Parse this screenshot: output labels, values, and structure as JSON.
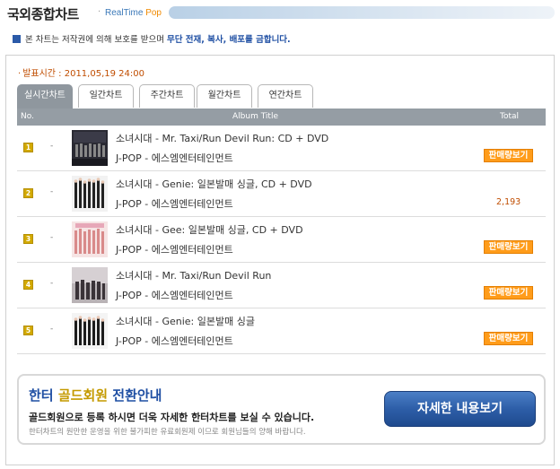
{
  "header": {
    "title": "국외종합차트",
    "separator": "·",
    "brand_realtime": "RealTime",
    "brand_pop": "Pop"
  },
  "notice": {
    "text": "본 차트는 저작권에 의해 보호를 받으며",
    "warning": "무단 전재, 복사, 배포를 금합니다."
  },
  "release_time": {
    "marker": "·",
    "text": "발표시간 : 2011,05,19 24:00"
  },
  "tabs": [
    {
      "label": "실시간차트",
      "active": true
    },
    {
      "label": "일간차트",
      "active": false
    },
    {
      "label": "주간차트",
      "active": false
    },
    {
      "label": "월간차트",
      "active": false
    },
    {
      "label": "연간차트",
      "active": false
    }
  ],
  "table": {
    "columns": {
      "no": "No.",
      "album_title": "Album Title",
      "total": "Total"
    },
    "rows": [
      {
        "rank": "1",
        "change": "-",
        "title": "소녀시대 - Mr. Taxi/Run Devil Run: CD + DVD",
        "artist": "J-POP - 에스엠엔터테인먼트",
        "total_button": "판매량보기",
        "total_value": ""
      },
      {
        "rank": "2",
        "change": "-",
        "title": "소녀시대 - Genie: 일본발매 싱글, CD + DVD",
        "artist": "J-POP - 에스엠엔터테인먼트",
        "total_button": "",
        "total_value": "2,193"
      },
      {
        "rank": "3",
        "change": "-",
        "title": "소녀시대 - Gee: 일본발매 싱글, CD + DVD",
        "artist": "J-POP - 에스엠엔터테인먼트",
        "total_button": "판매량보기",
        "total_value": ""
      },
      {
        "rank": "4",
        "change": "-",
        "title": "소녀시대 - Mr. Taxi/Run Devil Run",
        "artist": "J-POP - 에스엠엔터테인먼트",
        "total_button": "판매량보기",
        "total_value": ""
      },
      {
        "rank": "5",
        "change": "-",
        "title": "소녀시대 - Genie: 일본발매 싱글",
        "artist": "J-POP - 에스엠엔터테인먼트",
        "total_button": "판매량보기",
        "total_value": ""
      }
    ]
  },
  "promo": {
    "title_prefix": "한터",
    "title_gold": "골드회원",
    "title_suffix": "전환안내",
    "description": "골드회원으로 등록 하시면 더욱 자세한 한터차트를 보실 수 있습니다.",
    "note": "한터차트의 원만한 운영을 위한 불가피한 유료회원제 이므로 회원님들의 양해 바랍니다.",
    "button": "자세한 내용보기"
  },
  "colors": {
    "tab_active": "#8f979e",
    "table_header": "#959da4",
    "rank_badge": "#d2a900",
    "sale_button": "#ff9c1a",
    "accent_blue": "#1f4fa3",
    "release_orange": "#c04d00"
  }
}
